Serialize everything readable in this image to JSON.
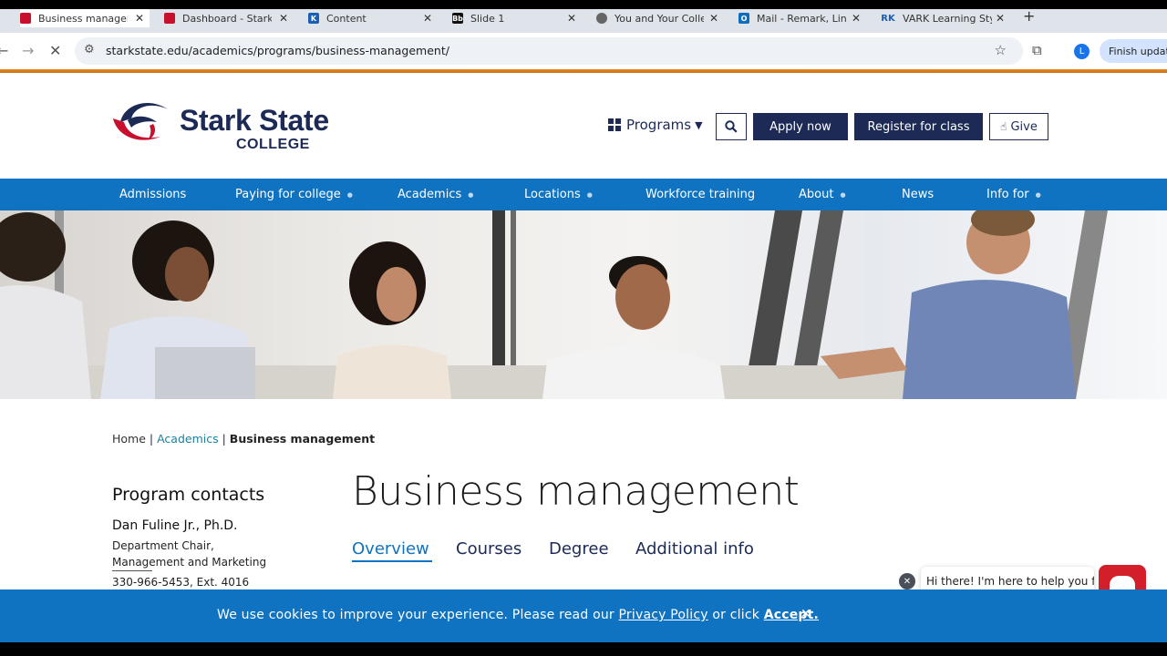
{
  "browser": {
    "tabs": [
      {
        "title": "Business manageme",
        "favicon": "stark-state-icon",
        "color": "#c8102e"
      },
      {
        "title": "Dashboard - Stark St",
        "favicon": "stark-state-icon",
        "color": "#c8102e"
      },
      {
        "title": "Content",
        "favicon": "content-icon",
        "color": "#1a5fb4"
      },
      {
        "title": "Slide 1",
        "favicon": "slide-icon",
        "color": "#111111"
      },
      {
        "title": "You and Your College",
        "favicon": "globe-icon",
        "color": "#555555"
      },
      {
        "title": "Mail - Remark, Linda",
        "favicon": "outlook-icon",
        "color": "#0f6cbd"
      },
      {
        "title": "VARK Learning Styles",
        "favicon": "vark-icon",
        "color": "#1a5fb4"
      }
    ],
    "url": "starkstate.edu/academics/programs/business-management/",
    "profile_initial": "L",
    "finish_update": "Finish update"
  },
  "header": {
    "logo_name": "Stark State",
    "logo_sub": "COLLEGE",
    "programs_label": "Programs",
    "apply_label": "Apply now",
    "register_label": "Register for class",
    "give_label": "Give"
  },
  "nav": [
    {
      "label": "Admissions"
    },
    {
      "label": "Paying for college"
    },
    {
      "label": "Academics"
    },
    {
      "label": "Locations"
    },
    {
      "label": "Workforce training"
    },
    {
      "label": "About"
    },
    {
      "label": "News"
    },
    {
      "label": "Info for"
    }
  ],
  "breadcrumb": {
    "home": "Home",
    "academics": "Academics",
    "current": "Business management"
  },
  "contacts": {
    "title": "Program contacts",
    "name": "Dan Fuline Jr., Ph.D.",
    "role_line1": "Department Chair,",
    "role_line2": "Management and Marketing",
    "phone": "330-966-5453, Ext. 4016"
  },
  "main": {
    "title": "Business management",
    "tabs": [
      {
        "label": "Overview"
      },
      {
        "label": "Courses"
      },
      {
        "label": "Degree"
      },
      {
        "label": "Additional info"
      }
    ]
  },
  "chat": {
    "greeting": "Hi there! I'm here to help you find"
  },
  "cookie": {
    "text_before": "We use cookies to improve your experience.  Please read our ",
    "privacy_link": "Privacy Policy",
    "text_middle": " or click ",
    "accept_link": "Accept."
  },
  "colors": {
    "brand_navy": "#1c2a55",
    "brand_blue": "#0f73c1",
    "brand_red": "#c8102e",
    "load_orange": "#e8861a"
  }
}
